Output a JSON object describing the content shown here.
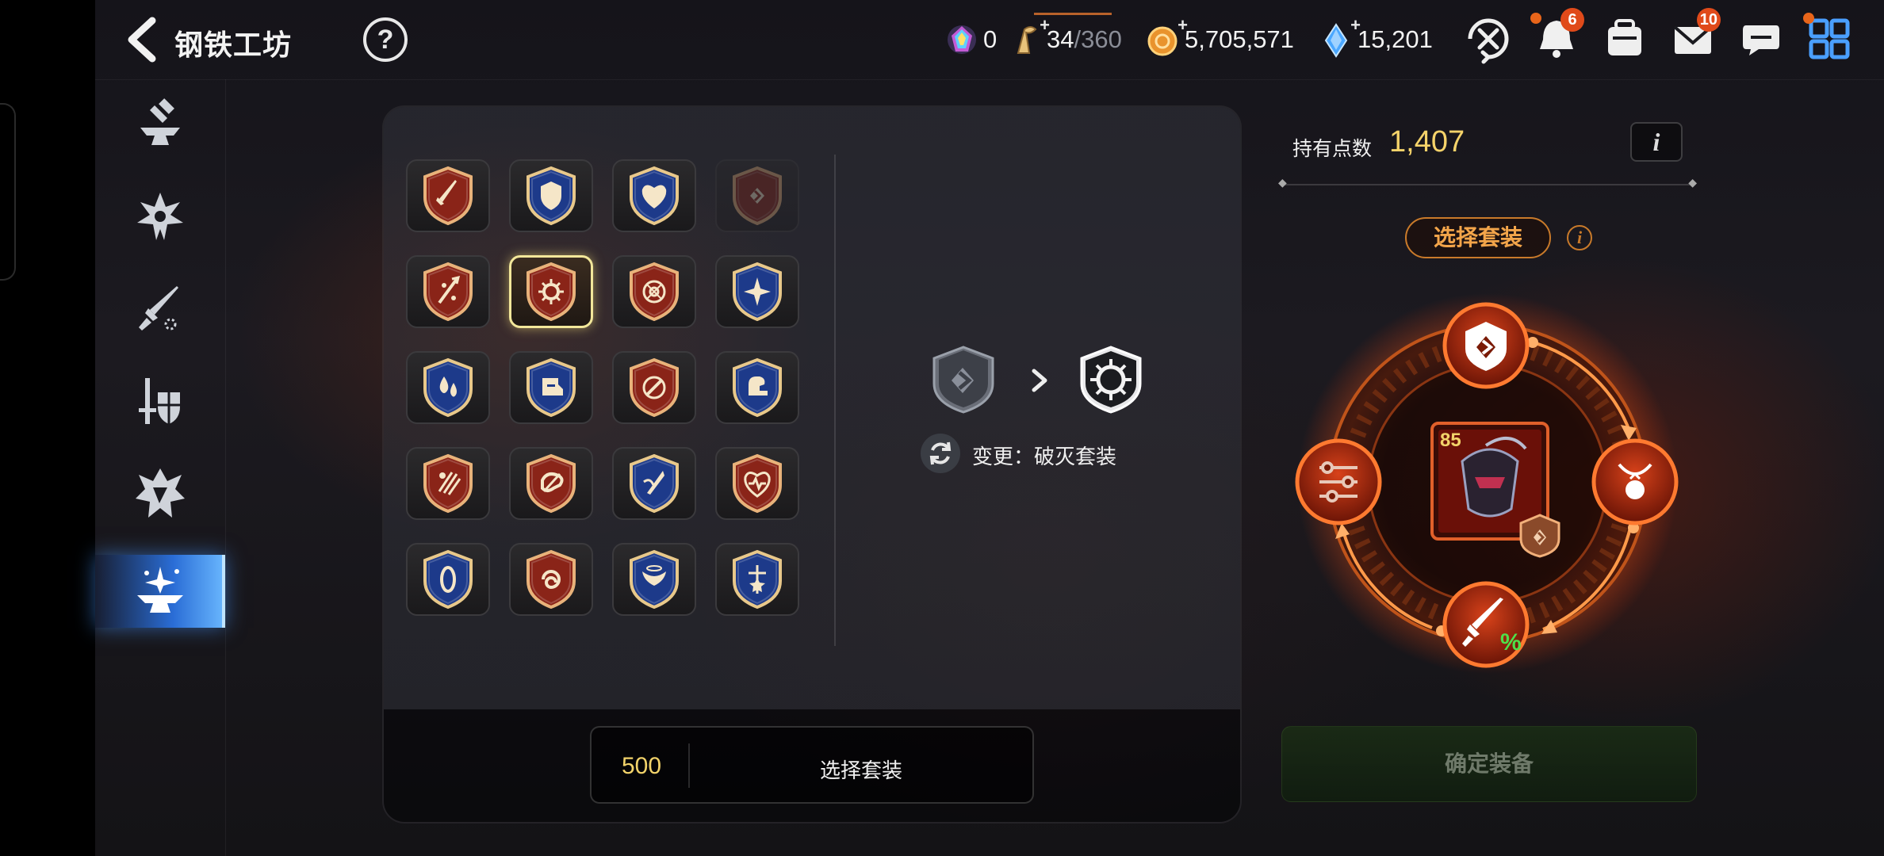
{
  "header": {
    "title": "钢铁工坊",
    "help_symbol": "?",
    "resources": [
      {
        "id": "crystal",
        "value": "0",
        "icon": "rainbow-crystal-icon"
      },
      {
        "id": "stamina",
        "value": "34",
        "sub": "/360",
        "icon": "key-stamina-icon"
      },
      {
        "id": "gold",
        "value": "5,705,571",
        "icon": "gold-coin-icon"
      },
      {
        "id": "gems",
        "value": "15,201",
        "icon": "blue-gem-icon"
      }
    ],
    "notifications_badge": "6",
    "mail_badge": "10"
  },
  "sidenav": [
    {
      "name": "anvil-hammer",
      "icon": "anvil-hammer-icon"
    },
    {
      "name": "flame-crest",
      "icon": "flame-crest-icon"
    },
    {
      "name": "sword-refine",
      "icon": "sword-refine-icon"
    },
    {
      "name": "sword-shield",
      "icon": "sword-shield-icon"
    },
    {
      "name": "shatter",
      "icon": "shatter-icon"
    },
    {
      "name": "sparkle-anvil",
      "icon": "sparkle-anvil-icon",
      "active": true
    }
  ],
  "set_grid": [
    [
      "sword",
      "shield",
      "heart",
      "chevron"
    ],
    [
      "spark-arrow",
      "burst",
      "target",
      "star-compass"
    ],
    [
      "drops",
      "boot",
      "slash-circle",
      "arm"
    ],
    [
      "claw",
      "fist",
      "blade",
      "heart-wave"
    ],
    [
      "oval-shield",
      "swirl",
      "wings",
      "star-cross"
    ]
  ],
  "change": {
    "from_icon": "chevron-set-icon",
    "to_icon": "burst-set-icon",
    "label": "变更：破灭套装"
  },
  "cost_bar": {
    "cost": "500",
    "label": "选择套装"
  },
  "right": {
    "points_label": "持有点数",
    "points_value": "1,407",
    "info_symbol": "i",
    "select_set_label": "选择套装",
    "item_level": "85",
    "confirm_label": "确定装备"
  },
  "colors": {
    "accent_gold": "#f5d36a",
    "accent_orange": "#f3a54a",
    "active_blue": "#2a6dd6",
    "ring_fire": "#ff5a1a"
  }
}
